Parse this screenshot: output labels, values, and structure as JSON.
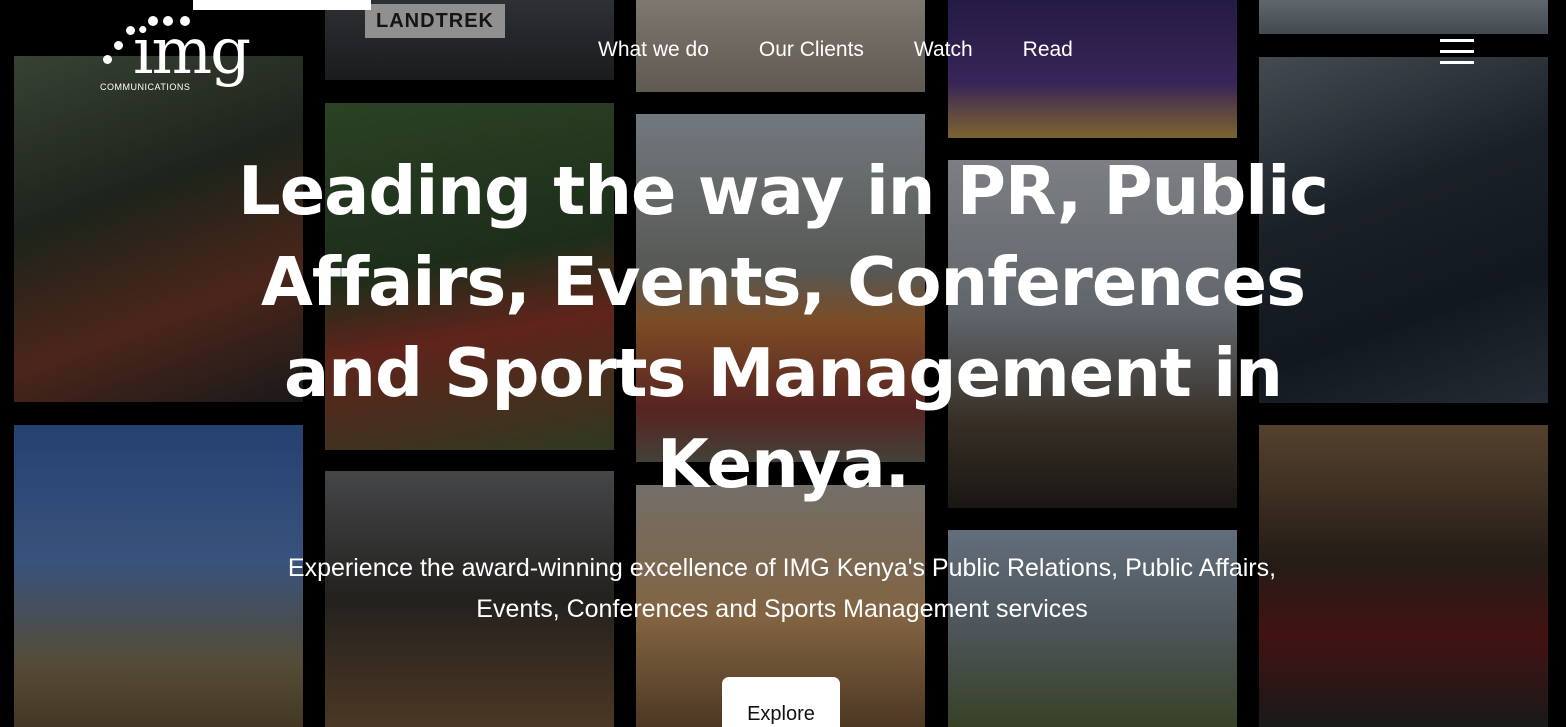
{
  "brand": {
    "logo_text": "img",
    "logo_subtext": "COMMUNICATIONS"
  },
  "nav": {
    "items": [
      {
        "label": "What we do"
      },
      {
        "label": "Our Clients"
      },
      {
        "label": "Watch"
      },
      {
        "label": "Read"
      }
    ],
    "menu_icon": "hamburger-icon"
  },
  "hero": {
    "title": "Leading the way in PR, Public Affairs, Events, Conferences and Sports Management in Kenya.",
    "subtitle": "Experience the award-winning excellence of IMG Kenya's Public Relations, Public Affairs, Events, Conferences and Sports Management services",
    "cta_label": "Explore"
  },
  "background": {
    "plate_text": "LANDTREK"
  },
  "colors": {
    "background": "#000000",
    "text": "#ffffff",
    "button_bg": "#ffffff",
    "button_text": "#111111"
  }
}
